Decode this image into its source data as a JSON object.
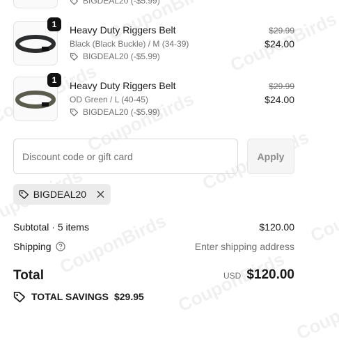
{
  "top_item": {
    "discount": "BIGDEAL20 (-$5.99)"
  },
  "items": [
    {
      "qty": "1",
      "name": "Heavy Duty Riggers Belt",
      "variant": "Black (Black Buckle) / M (34-39)",
      "discount": "BIGDEAL20 (-$5.99)",
      "old_price": "$29.99",
      "price": "$24.00",
      "belt_color": "#2b2d2e"
    },
    {
      "qty": "1",
      "name": "Heavy Duty Riggers Belt",
      "variant": "OD Green / L (40-45)",
      "discount": "BIGDEAL20 (-$5.99)",
      "old_price": "$29.99",
      "price": "$24.00",
      "belt_color": "#5c5c4e"
    }
  ],
  "discount_field": {
    "placeholder": "Discount code or gift card",
    "apply_label": "Apply"
  },
  "applied_code": {
    "code": "BIGDEAL20"
  },
  "summary": {
    "subtotal_label": "Subtotal · 5 items",
    "subtotal_value": "$120.00",
    "shipping_label": "Shipping",
    "shipping_value": "Enter shipping address",
    "total_label": "Total",
    "currency": "USD",
    "total_value": "$120.00",
    "savings_label": "TOTAL SAVINGS",
    "savings_value": "$29.95"
  },
  "watermark": "CouponBirds"
}
